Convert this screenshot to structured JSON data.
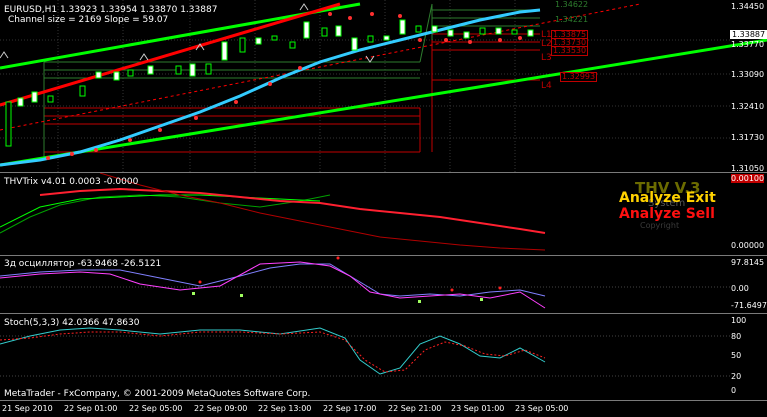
{
  "main_chart": {
    "title": "EURUSD,H1  1.33923 1.33954 1.33870 1.33887",
    "channel_info": "Channel size = 2169 Slope = 59.07",
    "price_scale": [
      "1.34450",
      "1.33887",
      "1.33770",
      "1.33090",
      "1.32410",
      "1.31730",
      "1.31050"
    ],
    "current_price": "1.33887",
    "levels": [
      {
        "label": "L1",
        "price": "1.33875"
      },
      {
        "label": "L2",
        "price": "1.33730"
      },
      {
        "label": "L3",
        "price": "1.33530"
      },
      {
        "label": "L4",
        "price": "1.32993"
      }
    ],
    "upper_levels": [
      "1.34622",
      "1.34221"
    ],
    "colors": {
      "up_channel": "#00ff00",
      "mid_line": "#ff0000",
      "trend": "#00bfff",
      "level": "#c00000"
    }
  },
  "thv_panel": {
    "label": "THVTrix v4.01 0.0003 -0.0000",
    "scale": [
      "0.00100",
      "0.00000"
    ],
    "overlay_title": "THV V.3",
    "overlay_sub": "System",
    "analyze_exit": "Analyze Exit",
    "analyze_sell": "Analyze Sell",
    "overlay_small": "Copyright"
  },
  "osc_panel": {
    "label": "3д осциллятор -63.9468 -26.5121",
    "scale": [
      "97.8145",
      "0.00",
      "-71.6497"
    ]
  },
  "stoch_panel": {
    "label": "Stoch(5,3,3) 42.0366 47.8630",
    "scale": [
      "100",
      "80",
      "50",
      "20",
      "0"
    ]
  },
  "copyright": "MetaTrader - FxCompany, © 2001-2009 MetaQuotes Software Corp.",
  "time_axis": [
    "21 Sep 2010",
    "22 Sep 01:00",
    "22 Sep 05:00",
    "22 Sep 09:00",
    "22 Sep 13:00",
    "22 Sep 17:00",
    "22 Sep 21:00",
    "23 Sep 01:00",
    "23 Sep 05:00"
  ]
}
